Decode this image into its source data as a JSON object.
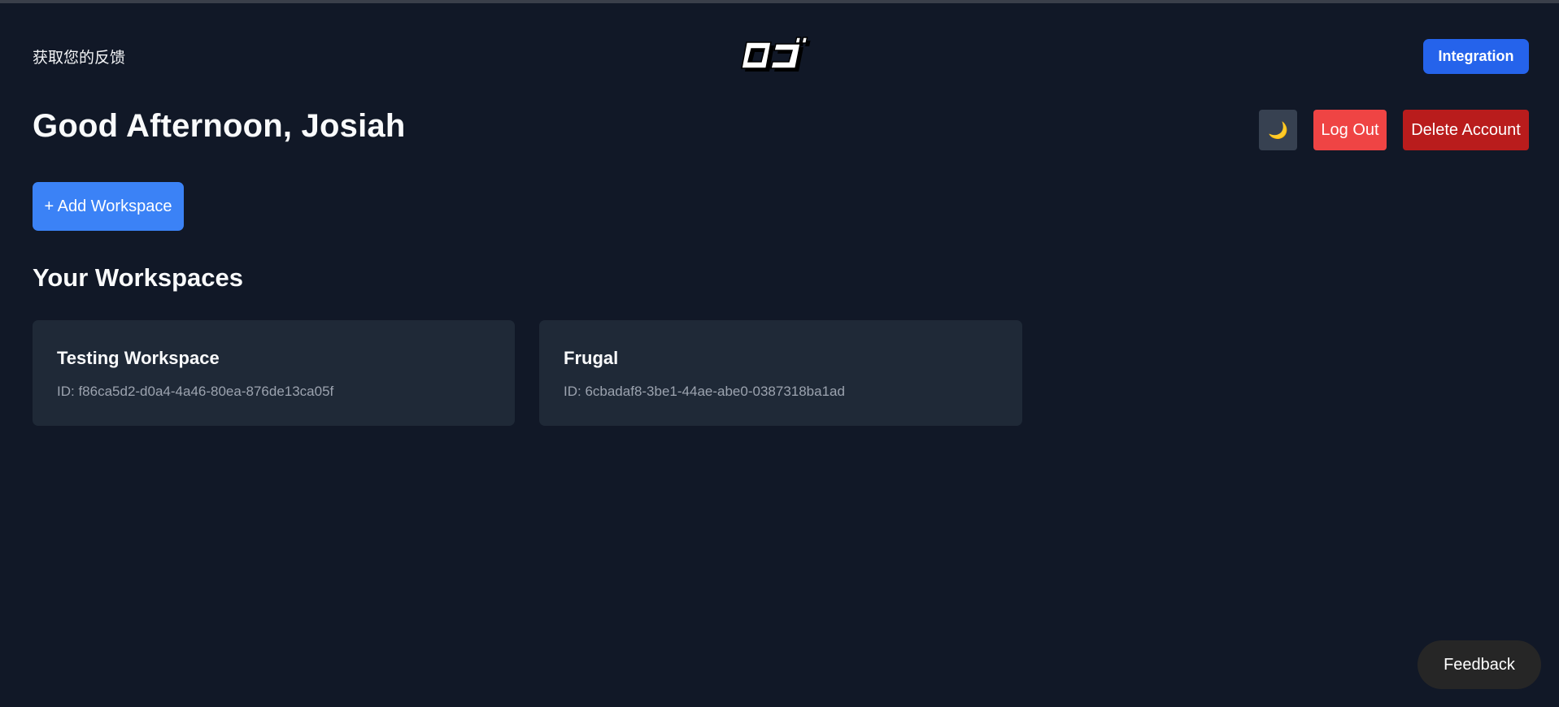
{
  "header": {
    "left_text": "获取您的反馈",
    "integration_label": "Integration"
  },
  "greeting": "Good Afternoon, Josiah",
  "actions": {
    "theme_icon": "moon-icon",
    "theme_glyph": "🌙",
    "logout_label": "Log Out",
    "delete_label": "Delete Account"
  },
  "add_workspace_label": "+ Add Workspace",
  "workspaces_title": "Your Workspaces",
  "workspaces": [
    {
      "name": "Testing Workspace",
      "id": "ID: f86ca5d2-d0a4-4a46-80ea-876de13ca05f"
    },
    {
      "name": "Frugal",
      "id": "ID: 6cbadaf8-3be1-44ae-abe0-0387318ba1ad"
    }
  ],
  "feedback_label": "Feedback",
  "colors": {
    "background": "#111827",
    "card": "#1f2937",
    "integration": "#2563eb",
    "add_workspace": "#3b82f6",
    "logout": "#ef4444",
    "delete": "#b91c1c",
    "theme_button": "#374151",
    "feedback": "#262626"
  }
}
